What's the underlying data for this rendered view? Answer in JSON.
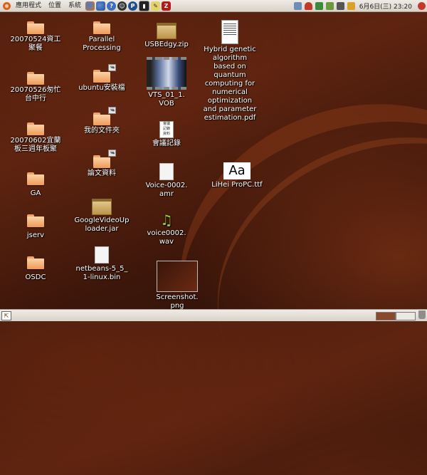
{
  "top_panel": {
    "menus": [
      "應用程式",
      "位置",
      "系統"
    ],
    "launchers": [
      "firefox-icon",
      "thunderbird-icon",
      "help-icon",
      "pidgin-icon",
      "p-app-icon",
      "terminal-icon",
      "editor-icon",
      "filezilla-icon"
    ],
    "clock": "6月6日(三) 23:20"
  },
  "desktop": {
    "col1": [
      {
        "label": "20070524資工\n聚餐",
        "type": "folder"
      },
      {
        "label": "20070526匆忙\n台中行",
        "type": "folder"
      },
      {
        "label": "20070602宜蘭\n板三週年板聚",
        "type": "folder"
      },
      {
        "label": "GA",
        "type": "folder"
      },
      {
        "label": "jserv",
        "type": "folder"
      },
      {
        "label": "OSDC",
        "type": "folder"
      }
    ],
    "col2": [
      {
        "label": "Parallel\nProcessing",
        "type": "folder"
      },
      {
        "label": "ubuntu安裝檔",
        "type": "folder-link"
      },
      {
        "label": "我的文件夾",
        "type": "folder-link"
      },
      {
        "label": "論文資料",
        "type": "folder-link"
      },
      {
        "label": "GoogleVideoUp\nloader.jar",
        "type": "archive"
      },
      {
        "label": "netbeans-5_5_\n1-linux.bin",
        "type": "file"
      }
    ],
    "col3": [
      {
        "label": "USBEdgy.zip",
        "type": "archive"
      },
      {
        "label": "VTS_01_1.\nVOB",
        "type": "video"
      },
      {
        "label": "會議記錄",
        "type": "document"
      },
      {
        "label": "Voice-0002.\namr",
        "type": "file"
      },
      {
        "label": "voice0002.\nwav",
        "type": "audio"
      },
      {
        "label": "Screenshot.\npng",
        "type": "image"
      }
    ],
    "col4": [
      {
        "label": "Hybrid genetic\nalgorithm\nbased on\nquantum\ncomputing for\nnumerical\noptimization\nand parameter\nestimation.pdf",
        "type": "pdf"
      },
      {
        "label": "LiHei ProPC.ttf",
        "type": "font"
      }
    ],
    "doc_icon_text": "會議\n記錄\n資料",
    "font_icon_text": "Aa"
  },
  "colors": {
    "panel": "#e6e1d9",
    "desktop_bg": "#4a1d0c",
    "folder": "#f0a26a"
  }
}
